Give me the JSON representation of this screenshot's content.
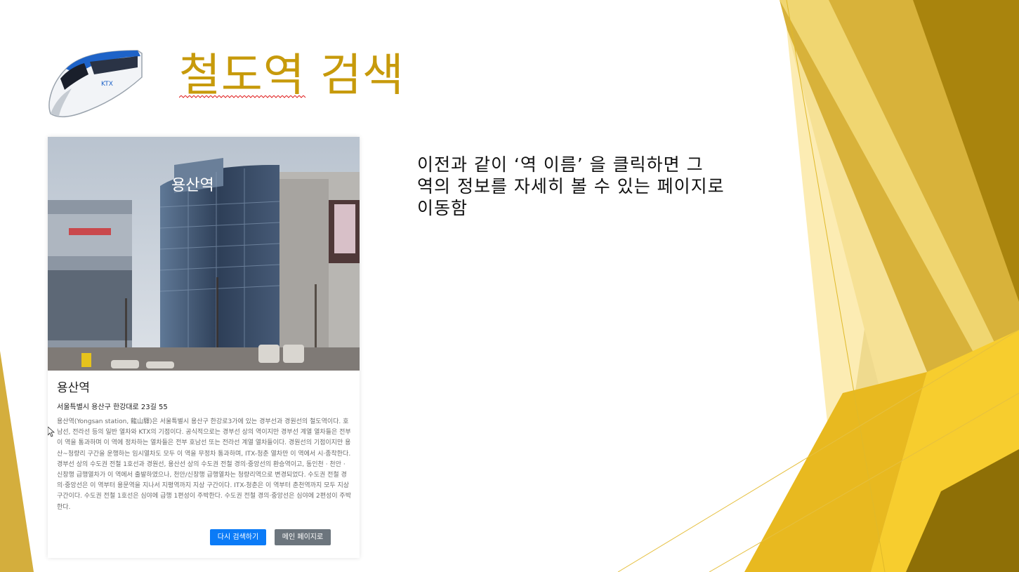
{
  "slide": {
    "title": "철도역 검색",
    "note": "이전과 같이 ‘역 이름’ 을 클릭하면 그 역의 정보를 자세히 볼 수 있는 페이지로 이동함",
    "logo_icon": "ktx-train-icon"
  },
  "station_card": {
    "name": "용산역",
    "address": "서울특별시 용산구 한강대로 23길 55",
    "photo_sign": "용산역",
    "description": "용산역(Yongsan station, 龍山驛)은 서울특별시 용산구 한강로3가에 있는 경부선과 경원선의 철도역이다. 호남선, 전라선 등의 일반 열차와 KTX의 기점이다. 공식적으로는 경부선 상의 역이지만 경부선 계열 열차들은 전부 이 역을 통과하며 이 역에 정차하는 열차들은 전부 호남선 또는 전라선 계열 열차들이다. 경원선의 기점이지만 용산~청량리 구간을 운행하는 임시열차도 모두 이 역을 무정차 통과하며, ITX-청춘 열차만 이 역에서 시·종착한다. 경부선 상의 수도권 전철 1호선과 경원선, 용산선 상의 수도권 전철 경의·중앙선의 환승역이고, 동인천 · 천안 · 신창행 급행열차가 이 역에서 출발하였으나, 천안/신창행 급행열차는 청량리역으로 변경되었다. 수도권 전철 경의·중앙선은 이 역부터 용문역을 지나서 지평역까지 지상 구간이다. ITX-청춘은 이 역부터 춘천역까지 모두 지상 구간이다. 수도권 전철 1호선은 심야에 급행 1편성이 주박한다. 수도권 전철 경의·중앙선은 심야에 2편성이 주박한다.",
    "search_again_label": "다시 검색하기",
    "main_page_label": "메인 페이지로"
  },
  "colors": {
    "title": "#c79a0b",
    "primary_button": "#0b7bf7",
    "secondary_button": "#6c757d",
    "gold_light": "#f6d35a",
    "gold_dark": "#9a7a08"
  }
}
